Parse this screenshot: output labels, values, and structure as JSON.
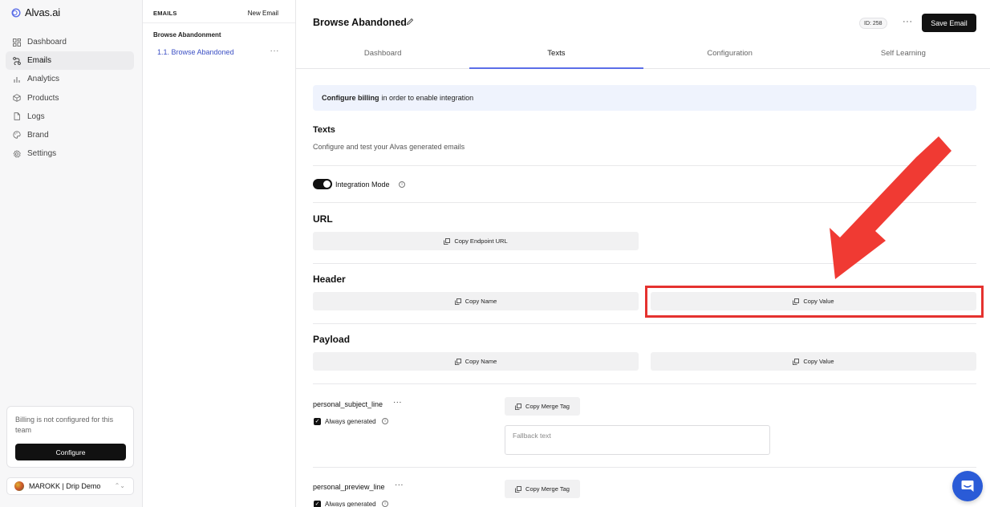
{
  "app": {
    "logo_text": "Alvas.ai"
  },
  "sidebar": {
    "items": [
      {
        "label": "Dashboard",
        "icon": "grid-icon",
        "active": false
      },
      {
        "label": "Emails",
        "icon": "route-icon",
        "active": true
      },
      {
        "label": "Analytics",
        "icon": "bar-chart-icon",
        "active": false
      },
      {
        "label": "Products",
        "icon": "box-icon",
        "active": false
      },
      {
        "label": "Logs",
        "icon": "file-icon",
        "active": false
      },
      {
        "label": "Brand",
        "icon": "palette-icon",
        "active": false
      },
      {
        "label": "Settings",
        "icon": "gear-icon",
        "active": false
      }
    ],
    "billing_notice": "Billing is not configured for this team",
    "billing_button": "Configure",
    "team_name": "MAROKK | Drip Demo"
  },
  "emails_panel": {
    "title": "EMAILS",
    "new_email": "New Email",
    "group_title": "Browse Abandonment",
    "item": "1.1. Browse Abandoned",
    "item_more": "···"
  },
  "main": {
    "title": "Browse Abandoned",
    "id_badge": "ID: 258",
    "more": "···",
    "save_button": "Save Email",
    "tabs": [
      {
        "label": "Dashboard",
        "active": false
      },
      {
        "label": "Texts",
        "active": true
      },
      {
        "label": "Configuration",
        "active": false
      },
      {
        "label": "Self Learning",
        "active": false
      }
    ],
    "banner": {
      "bold": "Configure billing",
      "rest": "in order to enable integration"
    },
    "texts_section": {
      "title": "Texts",
      "description": "Configure and test your Alvas generated emails"
    },
    "integration_mode": {
      "label": "Integration Mode",
      "enabled": true
    },
    "url_section": {
      "title": "URL",
      "button": "Copy Endpoint URL"
    },
    "header_section": {
      "title": "Header",
      "copy_name": "Copy Name",
      "copy_value": "Copy Value"
    },
    "payload_section": {
      "title": "Payload",
      "copy_name": "Copy Name",
      "copy_value": "Copy Value"
    },
    "fields": [
      {
        "name": "personal_subject_line",
        "always_generated": "Always generated",
        "merge_tag": "Copy Merge Tag",
        "fallback_placeholder": "Fallback text"
      },
      {
        "name": "personal_preview_line",
        "always_generated": "Always generated",
        "merge_tag": "Copy Merge Tag"
      }
    ]
  },
  "colors": {
    "accent": "#5b6ee8",
    "annotation": "#e5322f",
    "help_button": "#2a5bd7",
    "primary": "#111111"
  }
}
